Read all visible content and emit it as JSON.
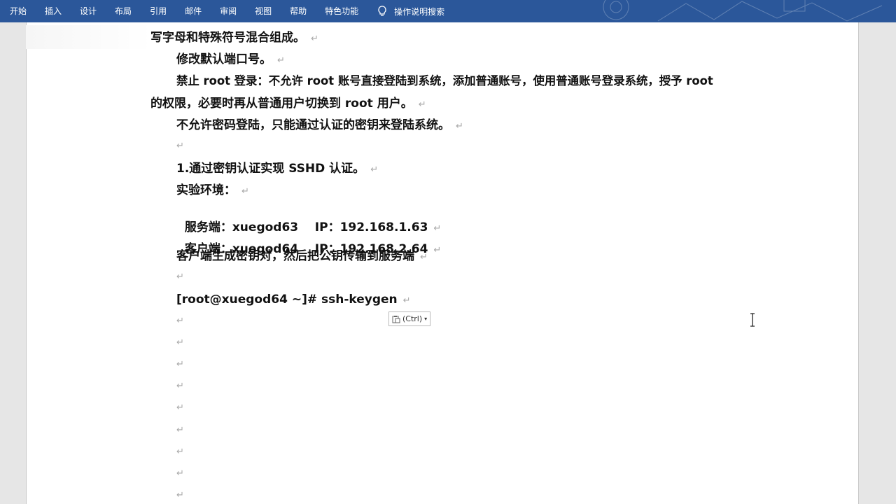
{
  "ribbon": {
    "tabs": [
      "开始",
      "插入",
      "设计",
      "布局",
      "引用",
      "邮件",
      "审阅",
      "视图",
      "帮助",
      "特色功能"
    ],
    "tellme_label": "操作说明搜索"
  },
  "document": {
    "lines": [
      "写字母和特殊符号混合组成。",
      "修改默认端口号。",
      "禁止 root 登录：不允许 root 账号直接登陆到系统，添加普通账号，使用普通账号登录系统，授予 root",
      "的权限，必要时再从普通用户切换到 root 用户。",
      "不允许密码登陆，只能通过认证的密钥来登陆系统。",
      "1.通过密钥认证实现 SSHD 认证。",
      "实验环境：",
      "服务端：xuegod63    IP：192.168.1.63",
      "客户端：xuegod64    IP：192.168.2.64",
      "客户端生成密钥对，然后把公钥传输到服务端",
      "[root@xuegod64 ~]# ssh-keygen"
    ],
    "paragraph_mark": "↵"
  },
  "paste_options": {
    "label": "(Ctrl)"
  }
}
